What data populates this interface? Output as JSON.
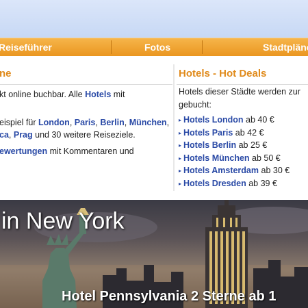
{
  "nav": {
    "items": [
      {
        "label": "Reiseführer"
      },
      {
        "label": "Fotos"
      },
      {
        "label": "Stadtpläne"
      }
    ]
  },
  "left": {
    "title": "ne",
    "line1_a": "kt online buchbar. Alle ",
    "line1_link": "Hotels",
    "line1_b": " mit",
    "line2_a": "eispiel für ",
    "cities": [
      "London",
      "Paris",
      "Berlin",
      "München"
    ],
    "line3_link_a": "ca",
    "line3_link_b": "Prag",
    "line3_b": " und 30 weitere Reiseziele.",
    "line4_link": "ewertungen",
    "line4_b": " mit Kommentaren und"
  },
  "right": {
    "title": "Hotels - Hot Deals",
    "intro_line1": "Hotels dieser Städte werden zur",
    "intro_line2": "gebucht:",
    "deals": [
      {
        "name": "Hotels London",
        "price": "ab 40 €"
      },
      {
        "name": "Hotels Paris",
        "price": "ab 42 €"
      },
      {
        "name": "Hotels Berlin",
        "price": "ab 25 €"
      },
      {
        "name": "Hotels München",
        "price": "ab 50 €"
      },
      {
        "name": "Hotels Amsterdam",
        "price": "ab 30 €"
      },
      {
        "name": "Hotels Dresden",
        "price": "ab 39 €"
      }
    ]
  },
  "banner": {
    "title": "in New York",
    "caption": "Hotel Pennsylvania 2 Sterne ab 1"
  }
}
